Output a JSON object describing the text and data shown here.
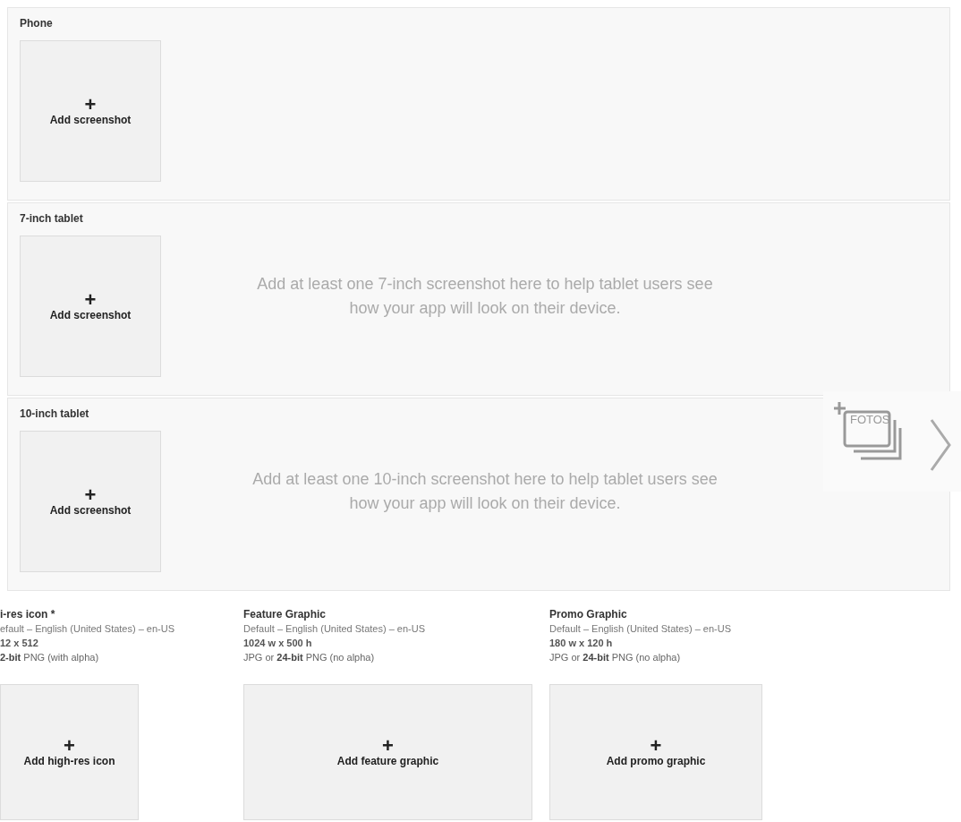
{
  "device_sections": [
    {
      "label": "Phone",
      "add_label": "+",
      "add_text": "Add screenshot"
    },
    {
      "label": "7-inch tablet",
      "add_label": "+",
      "add_text": "Add screenshot",
      "hint": "Add at least one 7-inch screenshot here to help tablet users see how your app will look on their device."
    },
    {
      "label": "10-inch tablet",
      "add_label": "+",
      "add_text": "Add screenshot",
      "hint": "Add at least one 10-inch screenshot here to help tablet users see how your app will look on their device."
    }
  ],
  "gallery_overlay": {
    "badge": "FOTOS"
  },
  "graphics": [
    {
      "title": "i-res icon *",
      "language": "efault – English (United States) – en-US",
      "size": "12 x 512",
      "format": "**2-bit** PNG (with alpha)",
      "add_label": "+",
      "add_text": "Add high-res icon"
    },
    {
      "title": "Feature Graphic",
      "language": "Default – English (United States) – en-US",
      "size": "1024 w x 500 h",
      "format": "JPG or **24-bit** PNG (no alpha)",
      "add_label": "+",
      "add_text": "Add feature graphic"
    },
    {
      "title": "Promo Graphic",
      "language": "Default – English (United States) – en-US",
      "size": "180 w x 120 h",
      "format": "JPG or **24-bit** PNG (no alpha)",
      "add_label": "+",
      "add_text": "Add promo graphic"
    }
  ]
}
